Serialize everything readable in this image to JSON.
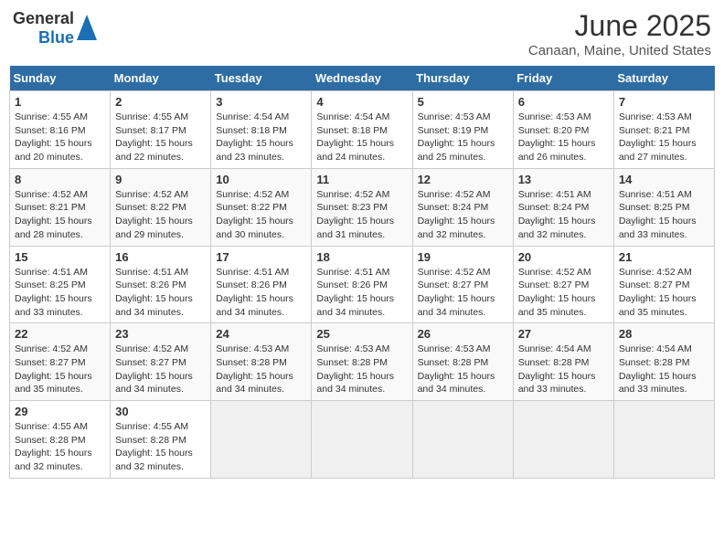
{
  "header": {
    "logo_general": "General",
    "logo_blue": "Blue",
    "month_title": "June 2025",
    "location": "Canaan, Maine, United States"
  },
  "weekdays": [
    "Sunday",
    "Monday",
    "Tuesday",
    "Wednesday",
    "Thursday",
    "Friday",
    "Saturday"
  ],
  "weeks": [
    [
      {
        "day": "1",
        "sunrise": "4:55 AM",
        "sunset": "8:16 PM",
        "daylight": "15 hours and 20 minutes."
      },
      {
        "day": "2",
        "sunrise": "4:55 AM",
        "sunset": "8:17 PM",
        "daylight": "15 hours and 22 minutes."
      },
      {
        "day": "3",
        "sunrise": "4:54 AM",
        "sunset": "8:18 PM",
        "daylight": "15 hours and 23 minutes."
      },
      {
        "day": "4",
        "sunrise": "4:54 AM",
        "sunset": "8:18 PM",
        "daylight": "15 hours and 24 minutes."
      },
      {
        "day": "5",
        "sunrise": "4:53 AM",
        "sunset": "8:19 PM",
        "daylight": "15 hours and 25 minutes."
      },
      {
        "day": "6",
        "sunrise": "4:53 AM",
        "sunset": "8:20 PM",
        "daylight": "15 hours and 26 minutes."
      },
      {
        "day": "7",
        "sunrise": "4:53 AM",
        "sunset": "8:21 PM",
        "daylight": "15 hours and 27 minutes."
      }
    ],
    [
      {
        "day": "8",
        "sunrise": "4:52 AM",
        "sunset": "8:21 PM",
        "daylight": "15 hours and 28 minutes."
      },
      {
        "day": "9",
        "sunrise": "4:52 AM",
        "sunset": "8:22 PM",
        "daylight": "15 hours and 29 minutes."
      },
      {
        "day": "10",
        "sunrise": "4:52 AM",
        "sunset": "8:22 PM",
        "daylight": "15 hours and 30 minutes."
      },
      {
        "day": "11",
        "sunrise": "4:52 AM",
        "sunset": "8:23 PM",
        "daylight": "15 hours and 31 minutes."
      },
      {
        "day": "12",
        "sunrise": "4:52 AM",
        "sunset": "8:24 PM",
        "daylight": "15 hours and 32 minutes."
      },
      {
        "day": "13",
        "sunrise": "4:51 AM",
        "sunset": "8:24 PM",
        "daylight": "15 hours and 32 minutes."
      },
      {
        "day": "14",
        "sunrise": "4:51 AM",
        "sunset": "8:25 PM",
        "daylight": "15 hours and 33 minutes."
      }
    ],
    [
      {
        "day": "15",
        "sunrise": "4:51 AM",
        "sunset": "8:25 PM",
        "daylight": "15 hours and 33 minutes."
      },
      {
        "day": "16",
        "sunrise": "4:51 AM",
        "sunset": "8:26 PM",
        "daylight": "15 hours and 34 minutes."
      },
      {
        "day": "17",
        "sunrise": "4:51 AM",
        "sunset": "8:26 PM",
        "daylight": "15 hours and 34 minutes."
      },
      {
        "day": "18",
        "sunrise": "4:51 AM",
        "sunset": "8:26 PM",
        "daylight": "15 hours and 34 minutes."
      },
      {
        "day": "19",
        "sunrise": "4:52 AM",
        "sunset": "8:27 PM",
        "daylight": "15 hours and 34 minutes."
      },
      {
        "day": "20",
        "sunrise": "4:52 AM",
        "sunset": "8:27 PM",
        "daylight": "15 hours and 35 minutes."
      },
      {
        "day": "21",
        "sunrise": "4:52 AM",
        "sunset": "8:27 PM",
        "daylight": "15 hours and 35 minutes."
      }
    ],
    [
      {
        "day": "22",
        "sunrise": "4:52 AM",
        "sunset": "8:27 PM",
        "daylight": "15 hours and 35 minutes."
      },
      {
        "day": "23",
        "sunrise": "4:52 AM",
        "sunset": "8:27 PM",
        "daylight": "15 hours and 34 minutes."
      },
      {
        "day": "24",
        "sunrise": "4:53 AM",
        "sunset": "8:28 PM",
        "daylight": "15 hours and 34 minutes."
      },
      {
        "day": "25",
        "sunrise": "4:53 AM",
        "sunset": "8:28 PM",
        "daylight": "15 hours and 34 minutes."
      },
      {
        "day": "26",
        "sunrise": "4:53 AM",
        "sunset": "8:28 PM",
        "daylight": "15 hours and 34 minutes."
      },
      {
        "day": "27",
        "sunrise": "4:54 AM",
        "sunset": "8:28 PM",
        "daylight": "15 hours and 33 minutes."
      },
      {
        "day": "28",
        "sunrise": "4:54 AM",
        "sunset": "8:28 PM",
        "daylight": "15 hours and 33 minutes."
      }
    ],
    [
      {
        "day": "29",
        "sunrise": "4:55 AM",
        "sunset": "8:28 PM",
        "daylight": "15 hours and 32 minutes."
      },
      {
        "day": "30",
        "sunrise": "4:55 AM",
        "sunset": "8:28 PM",
        "daylight": "15 hours and 32 minutes."
      },
      null,
      null,
      null,
      null,
      null
    ]
  ],
  "labels": {
    "sunrise": "Sunrise:",
    "sunset": "Sunset:",
    "daylight": "Daylight:"
  }
}
